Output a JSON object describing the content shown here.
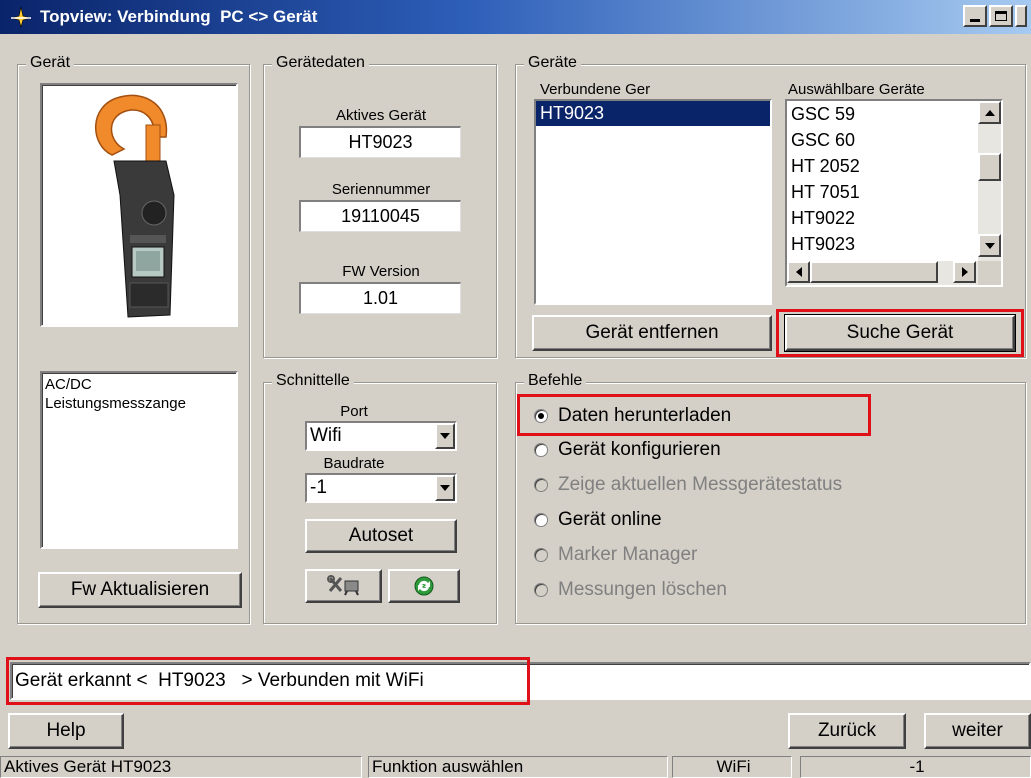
{
  "window": {
    "title": "Topview: Verbindung  PC <> Gerät"
  },
  "geraet": {
    "legend": "Gerät",
    "description": "AC/DC\nLeistungsmesszange",
    "fw_button": "Fw Aktualisieren"
  },
  "geraetedaten": {
    "legend": "Gerätedaten",
    "aktives_label": "Aktives Gerät",
    "aktives_value": "HT9023",
    "serien_label": "Seriennummer",
    "serien_value": "19110045",
    "fw_label": "FW Version",
    "fw_value": "1.01"
  },
  "geraete": {
    "legend": "Geräte",
    "connected_label": "Verbundene Ger",
    "connected": [
      "HT9023"
    ],
    "available_label": "Auswählbare Geräte",
    "available": [
      "GSC 59",
      "GSC 60",
      "HT 2052",
      "HT 7051",
      "HT9022",
      "HT9023"
    ],
    "remove_button": "Gerät entfernen",
    "search_button": "Suche Gerät"
  },
  "schnittstelle": {
    "legend": "Schnittelle",
    "port_label": "Port",
    "port_value": "Wifi",
    "baud_label": "Baudrate",
    "baud_value": "-1",
    "autoset_button": "Autoset",
    "tools_icon": "tools-icon",
    "refresh_icon": "refresh-icon"
  },
  "befehle": {
    "legend": "Befehle",
    "options": [
      {
        "label": "Daten herunterladen",
        "checked": true,
        "enabled": true
      },
      {
        "label": "Gerät konfigurieren",
        "checked": false,
        "enabled": true
      },
      {
        "label": "Zeige aktuellen Messgerätestatus",
        "checked": false,
        "enabled": false
      },
      {
        "label": "Gerät online",
        "checked": false,
        "enabled": true
      },
      {
        "label": "Marker Manager",
        "checked": false,
        "enabled": false
      },
      {
        "label": "Messungen löschen",
        "checked": false,
        "enabled": false
      }
    ]
  },
  "message": "Gerät erkannt <  HT9023   > Verbunden mit WiFi",
  "buttons": {
    "help": "Help",
    "back": "Zurück",
    "next": "weiter"
  },
  "statusbar": {
    "device": "Aktives Gerät HT9023",
    "function": "Funktion auswählen",
    "connection": "WiFi",
    "baud": "-1"
  },
  "colors": {
    "highlight": "#e01018",
    "selection": "#0a246a",
    "face": "#d4d0c8"
  }
}
